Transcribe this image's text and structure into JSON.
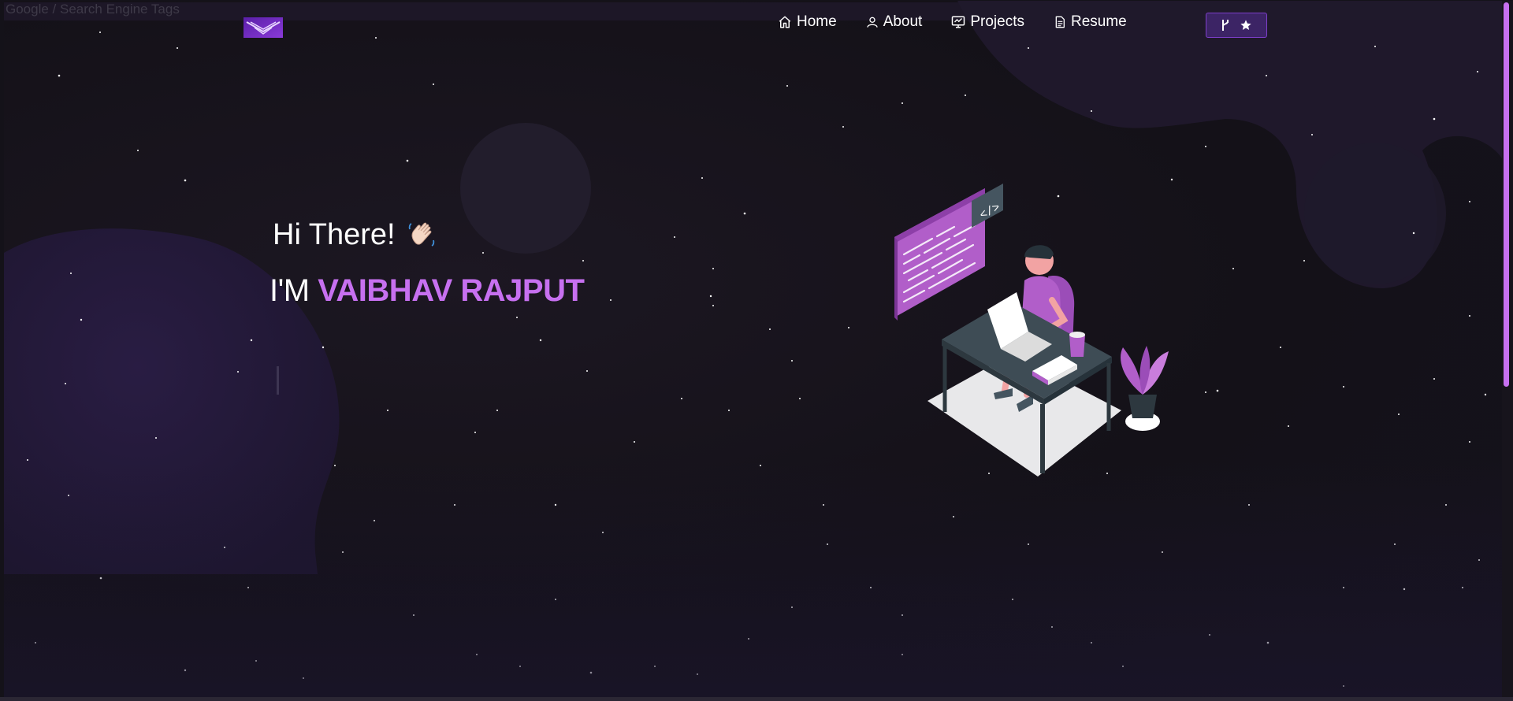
{
  "browser": {
    "tab_title": "Google / Search Engine Tags"
  },
  "nav": {
    "logo": "logo-icon",
    "items": [
      {
        "label": "Home",
        "icon": "home-icon"
      },
      {
        "label": "About",
        "icon": "user-icon"
      },
      {
        "label": "Projects",
        "icon": "projects-icon"
      },
      {
        "label": "Resume",
        "icon": "document-icon"
      }
    ],
    "github_button": {
      "icons": [
        "git-fork-icon",
        "star-icon"
      ]
    }
  },
  "hero": {
    "greeting": "Hi There!",
    "wave_icon": "waving-hand-icon",
    "intro_prefix": "I'M",
    "name": "VAIBHAV RAJPUT",
    "illustration": "developer-at-desk-illustration"
  },
  "colors": {
    "accent": "#c770f0",
    "background": "#141118",
    "button_bg": "#3c2465",
    "button_border": "#7d3fc9"
  }
}
